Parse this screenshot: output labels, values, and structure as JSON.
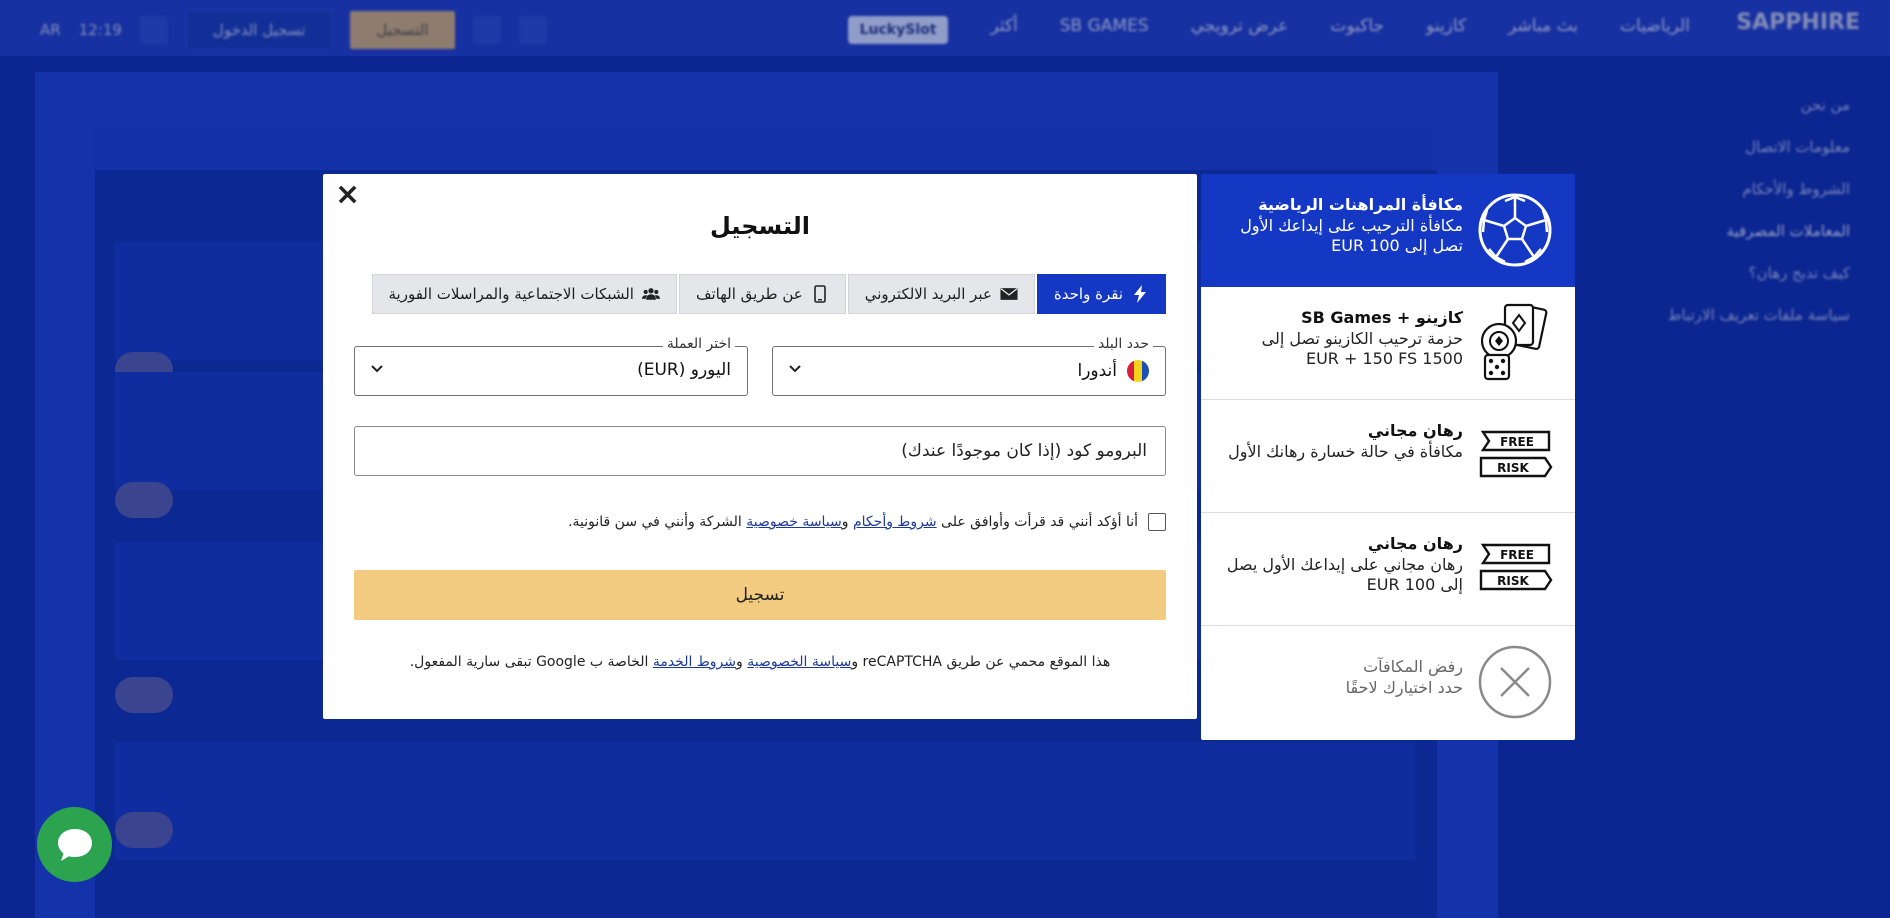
{
  "background": {
    "logo": "SAPPHIRE",
    "nav_items": [
      "الرياضيات",
      "بث مباشر",
      "كازينو",
      "جاكبوت",
      "عرض ترويجي",
      "SB GAMES",
      "أكثر"
    ],
    "lucky": "LuckySlot",
    "register_label": "التسجيل",
    "login_label": "تسجيل الدخول",
    "time": "12:19",
    "lang": "AR",
    "side_menu": [
      "من نحن",
      "معلومات الاتصال",
      "الشروط والأحكام",
      "المعاملات المصرفية",
      "كيف تدبج رهان؟",
      "سياسة ملفات تعريف الارتباط"
    ]
  },
  "modal": {
    "close": "×",
    "title": "التسجيل",
    "tabs": [
      {
        "label": "نقرة واحدة",
        "icon": "lightning-icon",
        "active": true
      },
      {
        "label": "عبر البريد الالكتروني",
        "icon": "envelope-icon",
        "active": false
      },
      {
        "label": "عن طريق الهاتف",
        "icon": "phone-icon",
        "active": false
      },
      {
        "label": "الشبكات الاجتماعية والمراسلات الفورية",
        "icon": "users-icon",
        "active": false
      }
    ],
    "country": {
      "label": "حدد البلد",
      "value": "أندورا"
    },
    "currency": {
      "label": "اختر العملة",
      "value": "اليورو (EUR)"
    },
    "promo_placeholder": "البرومو كود (إذا كان موجودًا عندك)",
    "consent": {
      "prefix": "أنا أؤكد أنني قد قرأت وأوافق على",
      "terms_link": "شروط وأحكام",
      "and": "و",
      "privacy_link": "سياسة خصوصية",
      "suffix": "الشركة وأنني في سن قانونية."
    },
    "submit_label": "تسجيل",
    "recaptcha": {
      "prefix": "هذا الموقع محمي عن طريق reCAPTCHA و",
      "privacy_link": "سياسة الخصوصية",
      "and": " و",
      "terms_link": "شروط الخدمة",
      "suffix": " الخاصة ب Google تبقى سارية المفعول."
    }
  },
  "bonuses": [
    {
      "title": "مكافأة المراهنات الرياضية",
      "desc": "مكافأة الترحيب على إيداعك الأول تصل إلى 100 EUR",
      "icon": "soccer-ball-icon",
      "active": true
    },
    {
      "title": "كازينو + SB Games",
      "desc": "حزمة ترحيب الكازينو تصل إلى 1500 EUR + 150 FS",
      "icon": "casino-chips-cards-icon",
      "active": false
    },
    {
      "title": "رهان مجاني",
      "desc": "مكافأة في حالة خسارة رهانك الأول",
      "icon": "free-risk-icon",
      "active": false
    },
    {
      "title": "رهان مجاني",
      "desc": "رهان مجاني على إيداعك الأول يصل إلى 100 EUR",
      "icon": "free-risk-icon",
      "active": false
    },
    {
      "title": "رفض المكافآت",
      "desc": "حدد اختيارك لاحقًا",
      "icon": "decline-icon",
      "active": false
    }
  ],
  "badges": {
    "free": "FREE",
    "risk": "RISK"
  },
  "colors": {
    "primary": "#1538c4",
    "submit": "#f2ca80",
    "chat": "#2ba34f",
    "background": "#0d2a9e"
  }
}
